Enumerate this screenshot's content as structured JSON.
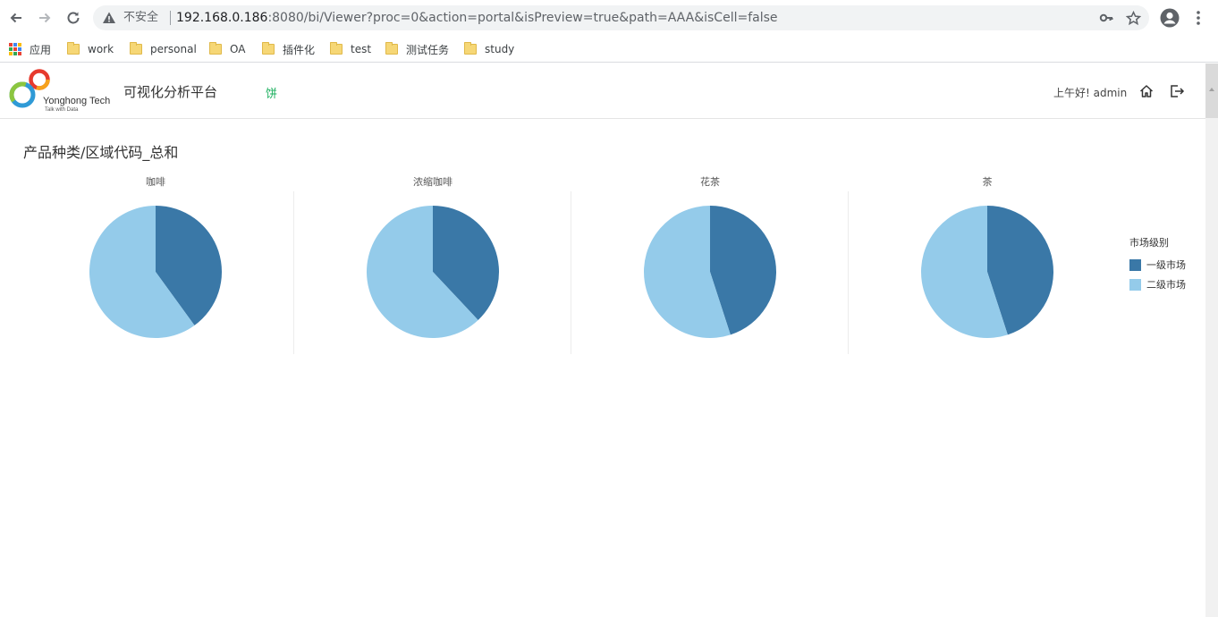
{
  "browser": {
    "insecure_label": "不安全",
    "url_host": "192.168.0.186",
    "url_rest": ":8080/bi/Viewer?proc=0&action=portal&isPreview=true&path=AAA&isCell=false",
    "bookmarks": [
      {
        "label": "应用",
        "icon": "apps-grid-icon"
      },
      {
        "label": "work",
        "icon": "folder-icon"
      },
      {
        "label": "personal",
        "icon": "folder-icon"
      },
      {
        "label": "OA",
        "icon": "folder-icon"
      },
      {
        "label": "插件化",
        "icon": "folder-icon"
      },
      {
        "label": "test",
        "icon": "folder-icon"
      },
      {
        "label": "测试任务",
        "icon": "folder-icon"
      },
      {
        "label": "study",
        "icon": "folder-icon"
      }
    ]
  },
  "app": {
    "logo_name": "Yonghong Tech",
    "logo_tagline": "Talk with Data",
    "platform_title": "可视化分析平台",
    "nav_tab": "饼",
    "greeting": "上午好! admin",
    "icons": [
      "home-icon",
      "logout-icon"
    ]
  },
  "report": {
    "title": "产品种类/区域代码_总和"
  },
  "colors": {
    "primary_market": "#3a78a7",
    "secondary_market": "#94cbea",
    "nav_tab_green": "#1aaf5d"
  },
  "chart_data": {
    "type": "pie",
    "facet_by": "产品种类",
    "legend_title": "市场级别",
    "legend_position": "right",
    "categories": [
      "一级市场",
      "二级市场"
    ],
    "facets": [
      {
        "name": "咖啡",
        "values": [
          0.4,
          0.6
        ]
      },
      {
        "name": "浓缩咖啡",
        "values": [
          0.38,
          0.62
        ]
      },
      {
        "name": "花茶",
        "values": [
          0.45,
          0.55
        ]
      },
      {
        "name": "茶",
        "values": [
          0.45,
          0.55
        ]
      }
    ]
  }
}
